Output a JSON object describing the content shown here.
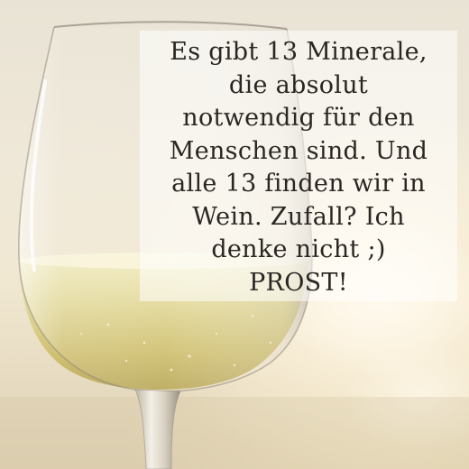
{
  "caption": {
    "text": "Es gibt 13 Minerale,\ndie absolut\nnotwendig für den\nMenschen sind. Und\nalle 13 finden wir in\nWein. Zufall? Ich\ndenke nicht ;)\nPROST!"
  },
  "colors": {
    "background": "#ece5d5",
    "wine": "#e4dca0",
    "text": "#2a2622"
  }
}
